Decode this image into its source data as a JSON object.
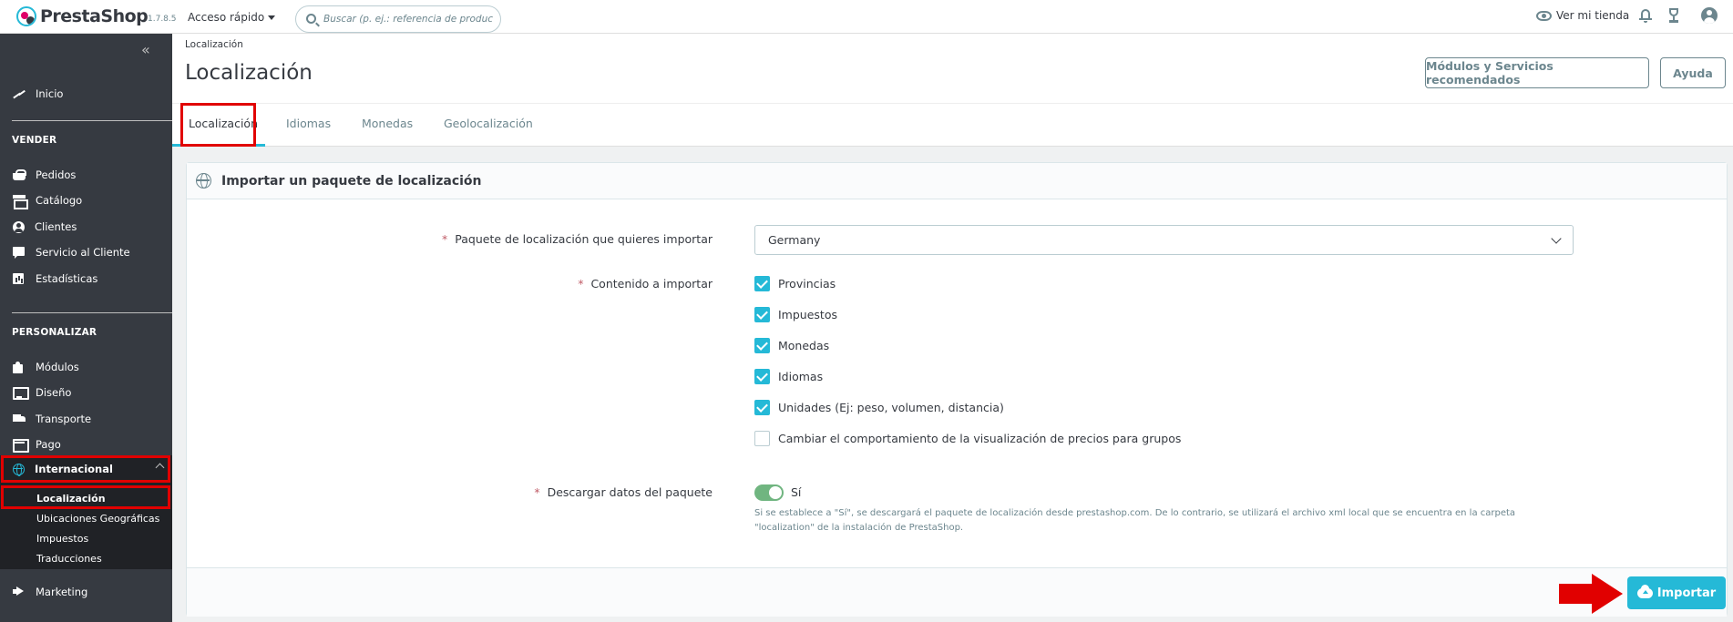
{
  "header": {
    "logo_text": "PrestaShop",
    "version": "1.7.8.5",
    "quick_access": "Acceso rápido",
    "search_placeholder": "Buscar (p. ej.: referencia de producto,",
    "view_store": "Ver mi tienda"
  },
  "sidebar": {
    "collapse_glyph": "«",
    "home": "Inicio",
    "section_sell": "VENDER",
    "sell_items": [
      "Pedidos",
      "Catálogo",
      "Clientes",
      "Servicio al Cliente",
      "Estadísticas"
    ],
    "section_customize": "PERSONALIZAR",
    "customize_items": [
      "Módulos",
      "Diseño",
      "Transporte",
      "Pago",
      "Internacional"
    ],
    "international_sub": [
      "Localización",
      "Ubicaciones Geográficas",
      "Impuestos",
      "Traducciones"
    ],
    "marketing": "Marketing"
  },
  "page": {
    "breadcrumb": "Localización",
    "title": "Localización",
    "btn_modules": "Módulos y Servicios recomendados",
    "btn_help": "Ayuda",
    "tabs": [
      "Localización",
      "Idiomas",
      "Monedas",
      "Geolocalización"
    ]
  },
  "form": {
    "card_title": "Importar un paquete de localización",
    "package_label": "Paquete de localización que quieres importar",
    "package_value": "Germany",
    "content_label": "Contenido a importar",
    "content_options": [
      {
        "label": "Provincias",
        "checked": true
      },
      {
        "label": "Impuestos",
        "checked": true
      },
      {
        "label": "Monedas",
        "checked": true
      },
      {
        "label": "Idiomas",
        "checked": true
      },
      {
        "label": "Unidades (Ej: peso, volumen, distancia)",
        "checked": true
      },
      {
        "label": "Cambiar el comportamiento de la visualización de precios para grupos",
        "checked": false
      }
    ],
    "download_label": "Descargar datos del paquete",
    "download_value": "Sí",
    "download_on": true,
    "help_text": "Si se establece a \"Sí\", se descargará el paquete de localización desde prestashop.com. De lo contrario, se utilizará el archivo xml local que se encuentra en la carpeta \"localization\" de la instalación de PrestaShop.",
    "required_marker": "*",
    "import_button": "Importar"
  },
  "colors": {
    "primary": "#25b9d7",
    "sidebar_bg": "#363a41",
    "highlight": "#e10000",
    "switch_on": "#70b580"
  }
}
